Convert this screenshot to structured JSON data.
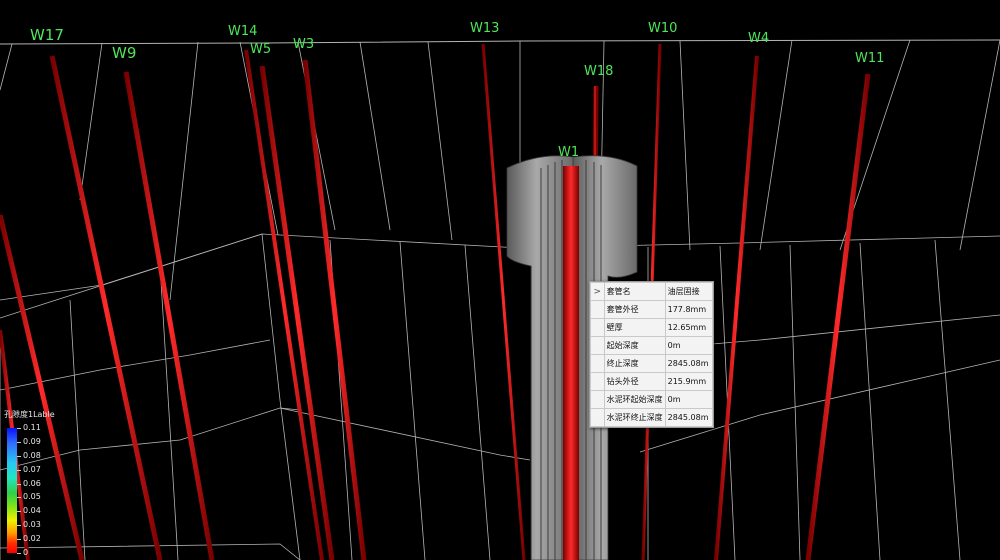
{
  "scene": {
    "wells": [
      {
        "name": "W17"
      },
      {
        "name": "W9"
      },
      {
        "name": "W14"
      },
      {
        "name": "W5"
      },
      {
        "name": "W3"
      },
      {
        "name": "W13"
      },
      {
        "name": "W18"
      },
      {
        "name": "W10"
      },
      {
        "name": "W4"
      },
      {
        "name": "W11"
      },
      {
        "name": "W1"
      }
    ]
  },
  "property_panel": {
    "rows": [
      {
        "key": "套管名",
        "value": "油层固接"
      },
      {
        "key": "套管外径",
        "value": "177.8mm"
      },
      {
        "key": "壁厚",
        "value": "12.65mm"
      },
      {
        "key": "起始深度",
        "value": "0m"
      },
      {
        "key": "终止深度",
        "value": "2845.08m"
      },
      {
        "key": "钻头外径",
        "value": "215.9mm"
      },
      {
        "key": "水泥环起始深度",
        "value": "0m"
      },
      {
        "key": "水泥环终止深度",
        "value": "2845.08m"
      }
    ],
    "expand_glyph": ">"
  },
  "legend": {
    "title": "孔隙度1Lable",
    "ticks": [
      "0.11",
      "0.09",
      "0.08",
      "0.07",
      "0.06",
      "0.05",
      "0.04",
      "0.03",
      "0.02",
      "0"
    ]
  },
  "colors": {
    "well_trajectory": "#ff1a1a",
    "well_label": "#4ee65a",
    "grid": "#b4b4b4",
    "background": "#000000"
  }
}
